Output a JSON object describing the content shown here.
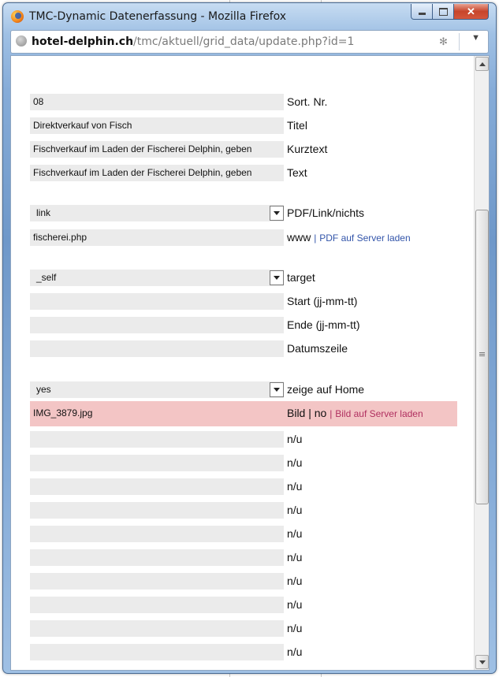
{
  "window": {
    "title": "TMC-Dynamic Datenerfassung - Mozilla Firefox",
    "url_host": "hotel-delphin.ch",
    "url_path": "/tmc/aktuell/grid_data/update.php?id=1"
  },
  "form": {
    "sort_nr": {
      "value": "08",
      "label": "Sort. Nr."
    },
    "titel": {
      "value": "Direktverkauf von Fisch",
      "label": "Titel"
    },
    "kurztext": {
      "value": "Fischverkauf im Laden der Fischerei Delphin, geben",
      "label": "Kurztext"
    },
    "text": {
      "value": "Fischverkauf im Laden der Fischerei Delphin, geben",
      "label": "Text"
    },
    "pdf_link": {
      "value": "link",
      "label": "PDF/Link/nichts"
    },
    "www": {
      "value": "fischerei.php",
      "label": "www",
      "separator": "|",
      "link": "PDF auf Server laden"
    },
    "target": {
      "value": "_self",
      "label": "target"
    },
    "start": {
      "value": "",
      "label": "Start (jj-mm-tt)"
    },
    "ende": {
      "value": "",
      "label": "Ende (jj-mm-tt)"
    },
    "datumszeile": {
      "value": "",
      "label": "Datumszeile"
    },
    "zeige_home": {
      "value": "yes",
      "label": "zeige auf Home"
    },
    "bild": {
      "value": "IMG_3879.jpg",
      "label": "Bild | no",
      "separator": "|",
      "link": "Bild auf Server laden"
    },
    "nu_rows": [
      "n/u",
      "n/u",
      "n/u",
      "n/u",
      "n/u",
      "n/u",
      "n/u",
      "n/u",
      "n/u",
      "n/u"
    ]
  },
  "colors": {
    "highlight": "#f3c5c5",
    "field_bg": "#ebebeb",
    "link_blue": "#3355aa",
    "link_pink": "#b03060"
  }
}
